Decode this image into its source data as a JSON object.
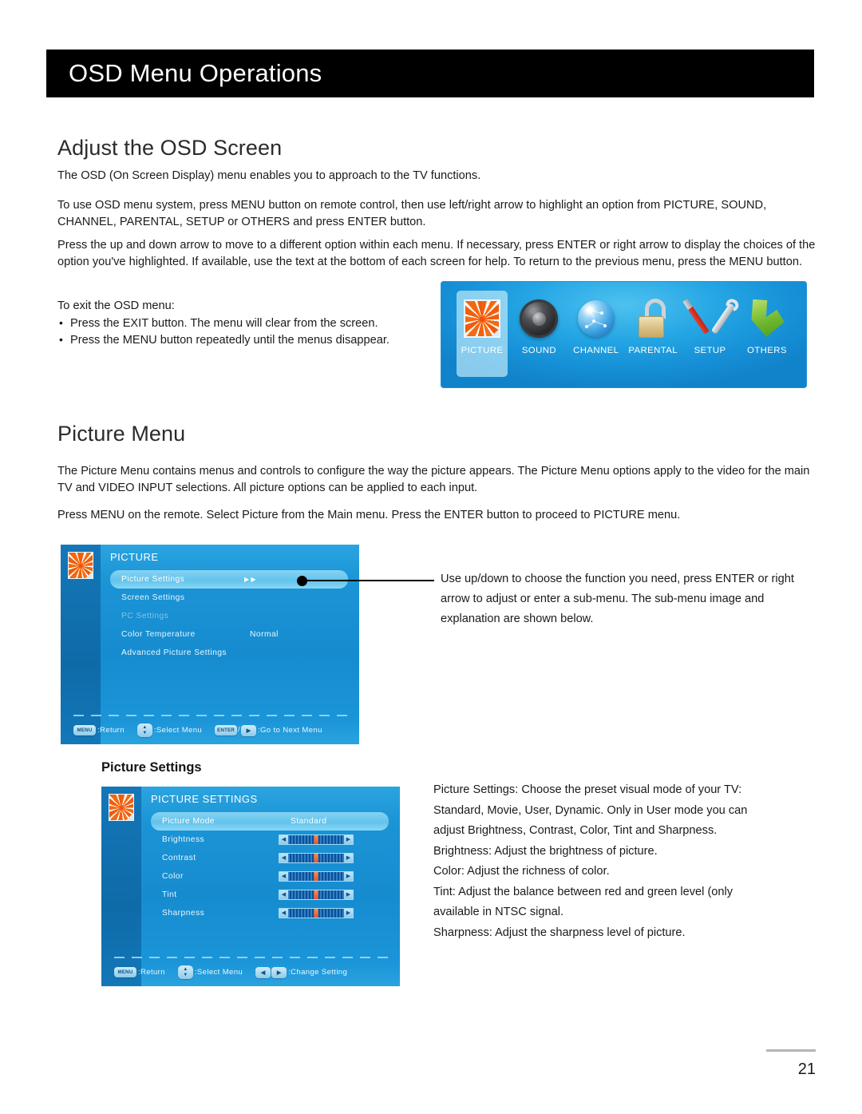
{
  "header": {
    "title": "OSD Menu Operations"
  },
  "section1": {
    "heading": "Adjust the OSD Screen",
    "p1": "The OSD (On Screen Display) menu enables you to approach to the TV functions.",
    "p2": "To use OSD menu system, press MENU button on remote control, then use left/right arrow to highlight an option from PICTURE, SOUND, CHANNEL, PARENTAL, SETUP or OTHERS and press ENTER button.",
    "p3": "Press the up and down arrow to move to a different option within each menu. If necessary, press ENTER or right arrow to display the choices of the option you've highlighted. If available, use the text at the bottom of each screen for help. To return to the previous menu, press the MENU button.",
    "exit_intro": "To exit the OSD menu:",
    "bullets": [
      "Press the EXIT button. The menu will clear from the screen.",
      "Press the MENU button repeatedly until the menus disappear."
    ]
  },
  "main_menu_image": {
    "items": [
      {
        "label": "PICTURE",
        "icon": "flower-picture-icon",
        "selected": true
      },
      {
        "label": "SOUND",
        "icon": "speaker-icon",
        "selected": false
      },
      {
        "label": "CHANNEL",
        "icon": "globe-network-icon",
        "selected": false
      },
      {
        "label": "PARENTAL",
        "icon": "padlock-icon",
        "selected": false
      },
      {
        "label": "SETUP",
        "icon": "wrench-screwdriver-icon",
        "selected": false
      },
      {
        "label": "OTHERS",
        "icon": "green-arrow-icon",
        "selected": false
      }
    ]
  },
  "section2": {
    "heading": "Picture Menu",
    "p1": "The Picture Menu contains menus and controls to configure the way the picture appears. The Picture Menu options apply to the video for the main TV and VIDEO INPUT selections. All picture options can be applied to each input.",
    "p2": "Press MENU on the remote. Select Picture from the Main menu. Press the ENTER button to proceed to PICTURE menu."
  },
  "picture_menu_osd": {
    "title": "PICTURE",
    "rows": [
      {
        "label": "Picture Settings",
        "value": "",
        "state": "selected",
        "arrows": true
      },
      {
        "label": "Screen Settings",
        "value": "",
        "state": "normal",
        "arrows": false
      },
      {
        "label": "PC Settings",
        "value": "",
        "state": "disabled",
        "arrows": false
      },
      {
        "label": "Color Temperature",
        "value": "Normal",
        "state": "normal",
        "arrows": false
      },
      {
        "label": "Advanced Picture Settings",
        "value": "",
        "state": "normal",
        "arrows": false
      }
    ],
    "hints": [
      {
        "key": "MENU",
        "key_type": "wide",
        "text": ":Return"
      },
      {
        "key": "updown",
        "key_type": "updown",
        "text": ":Select Menu"
      },
      {
        "key": "ENTER",
        "key_type": "enter-right",
        "text": ":Go to Next Menu"
      }
    ]
  },
  "callout1": "Use up/down to choose the function you need, press ENTER or right arrow to adjust or enter a sub-menu. The sub-menu image and explanation are shown below.",
  "picture_settings": {
    "heading": "Picture Settings",
    "osd": {
      "title": "PICTURE SETTINGS",
      "rows": [
        {
          "label": "Picture Mode",
          "value": "Standard",
          "type": "value",
          "state": "selected"
        },
        {
          "label": "Brightness",
          "value": 50,
          "type": "slider",
          "state": "normal"
        },
        {
          "label": "Contrast",
          "value": 50,
          "type": "slider",
          "state": "normal"
        },
        {
          "label": "Color",
          "value": 50,
          "type": "slider",
          "state": "normal"
        },
        {
          "label": "Tint",
          "value": 50,
          "type": "slider",
          "state": "normal"
        },
        {
          "label": "Sharpness",
          "value": 50,
          "type": "slider",
          "state": "normal"
        }
      ],
      "hints": [
        {
          "key": "MENU",
          "key_type": "wide",
          "text": ":Return"
        },
        {
          "key": "updown",
          "key_type": "updown",
          "text": ":Select Menu"
        },
        {
          "key": "leftright",
          "key_type": "leftright",
          "text": ":Change Setting"
        }
      ]
    },
    "description_lines": [
      "Picture Settings: Choose the preset visual mode of your TV:",
      "Standard, Movie, User, Dynamic. Only in User mode you can",
      "adjust Brightness, Contrast, Color, Tint and Sharpness.",
      "Brightness: Adjust the brightness of picture.",
      "Color: Adjust the richness of color.",
      "Tint: Adjust the balance between red and green level (only",
      "available in NTSC signal.",
      "Sharpness: Adjust the sharpness level of picture."
    ]
  },
  "footer": {
    "page_number": "21"
  },
  "colors": {
    "header_bar": "#000000",
    "osd_blue": "#168ccf",
    "osd_highlight": "#62c3ec",
    "slider_knob": "#f2531b",
    "accent_text": "#ffffff"
  }
}
